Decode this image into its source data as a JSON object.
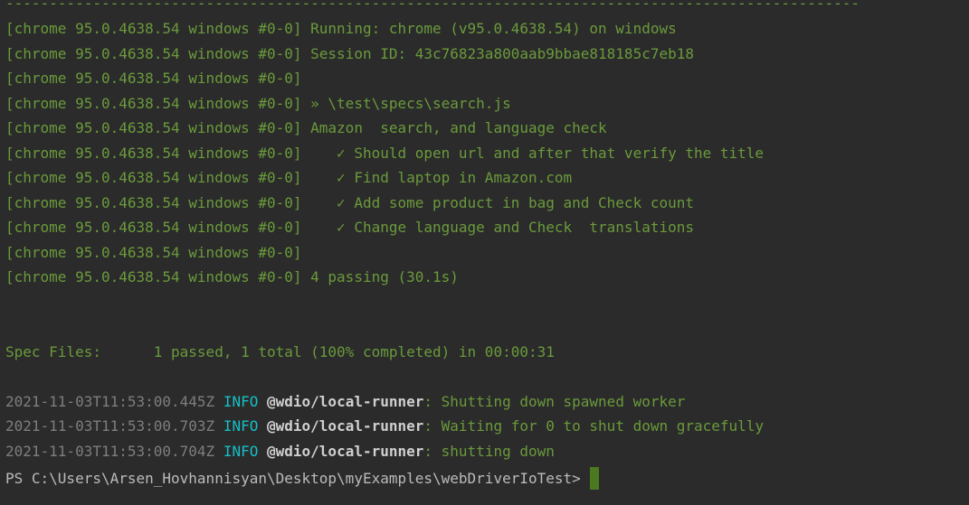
{
  "terminal": {
    "dash_line": "--------------------------------------------------------------------------------------------------",
    "spec_lines": [
      {
        "prefix": "[chrome 95.0.4638.54 windows #0-0]",
        "text": " Running: chrome (v95.0.4638.54) on windows"
      },
      {
        "prefix": "[chrome 95.0.4638.54 windows #0-0]",
        "text": " Session ID: 43c76823a800aab9bbae818185c7eb18"
      },
      {
        "prefix": "[chrome 95.0.4638.54 windows #0-0]",
        "text": ""
      },
      {
        "prefix": "[chrome 95.0.4638.54 windows #0-0]",
        "text": " » \\test\\specs\\search.js"
      },
      {
        "prefix": "[chrome 95.0.4638.54 windows #0-0]",
        "text": " Amazon  search, and language check"
      },
      {
        "prefix": "[chrome 95.0.4638.54 windows #0-0]",
        "text": "    ✓ Should open url and after that verify the title"
      },
      {
        "prefix": "[chrome 95.0.4638.54 windows #0-0]",
        "text": "    ✓ Find laptop in Amazon.com"
      },
      {
        "prefix": "[chrome 95.0.4638.54 windows #0-0]",
        "text": "    ✓ Add some product in bag and Check count"
      },
      {
        "prefix": "[chrome 95.0.4638.54 windows #0-0]",
        "text": "    ✓ Change language and Check  translations"
      },
      {
        "prefix": "[chrome 95.0.4638.54 windows #0-0]",
        "text": ""
      },
      {
        "prefix": "[chrome 95.0.4638.54 windows #0-0]",
        "text": " 4 passing (30.1s)"
      }
    ],
    "spec_files": "Spec Files:      1 passed, 1 total (100% completed) in 00:00:31",
    "log_lines": [
      {
        "timestamp": "2021-11-03T11:53:00.445Z",
        "level": "INFO",
        "source": "@wdio/local-runner",
        "message": ": Shutting down spawned worker"
      },
      {
        "timestamp": "2021-11-03T11:53:00.703Z",
        "level": "INFO",
        "source": "@wdio/local-runner",
        "message": ": Waiting for 0 to shut down gracefully"
      },
      {
        "timestamp": "2021-11-03T11:53:00.704Z",
        "level": "INFO",
        "source": "@wdio/local-runner",
        "message": ": shutting down"
      }
    ],
    "prompt": "PS C:\\Users\\Arsen_Hovhannisyan\\Desktop\\myExamples\\webDriverIoTest>",
    "colors": {
      "background": "#2b2b2b",
      "green_text": "#6a9a3b",
      "gray_text": "#7e7e7e",
      "info_cyan": "#16bfc6",
      "cursor": "#4a7a20"
    }
  }
}
